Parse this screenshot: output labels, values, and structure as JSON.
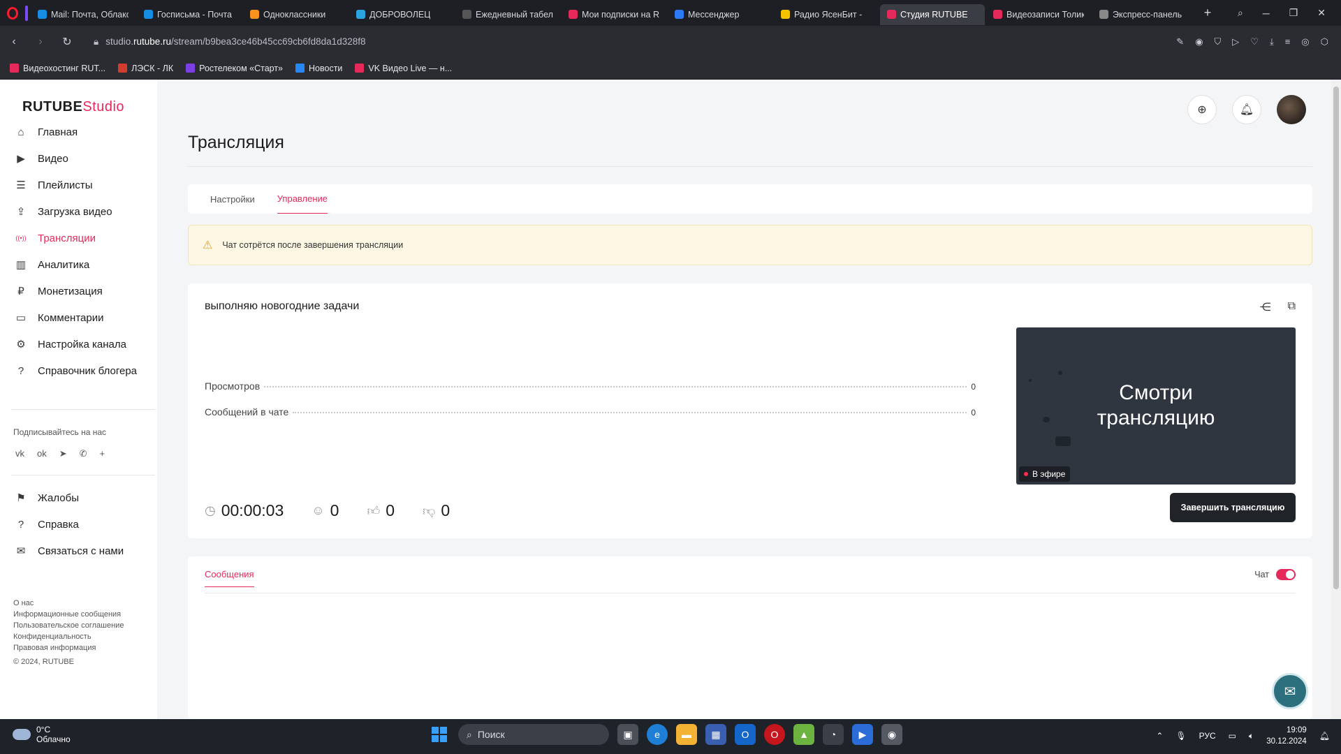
{
  "browser": {
    "tabs": [
      {
        "title": "Mail: Почта, Облако, ",
        "color": "#168de2",
        "active": false
      },
      {
        "title": "Госписьма - Почта M",
        "color": "#168de2",
        "active": false
      },
      {
        "title": "Одноклассники",
        "color": "#f7931e",
        "active": false
      },
      {
        "title": "ДОБРОВОЛЕЦ",
        "color": "#2aa3e0",
        "active": false
      },
      {
        "title": "Ежедневный табель",
        "color": "#555555",
        "active": false
      },
      {
        "title": "Мои подписки на RU",
        "color": "#e6295b",
        "active": false
      },
      {
        "title": "Мессенджер",
        "color": "#2d7bf4",
        "active": false
      },
      {
        "title": "Радио ЯсенБит - ",
        "color": "#f5c400",
        "active": false
      },
      {
        "title": "Студия RUTUBE",
        "color": "#e6295b",
        "active": true
      },
      {
        "title": "Видеозаписи Толика",
        "color": "#e6295b",
        "active": false
      },
      {
        "title": "Экспресс-панель",
        "color": "#888888",
        "active": false
      }
    ],
    "url_prefix": "studio.",
    "url_domain": "rutube.ru",
    "url_path": "/stream/b9bea3ce46b45cc69cb6fd8da1d328f8",
    "bookmarks": [
      {
        "label": "Видеохостинг RUT...",
        "color": "#e6295b"
      },
      {
        "label": "ЛЭСК - ЛК",
        "color": "#d23c2c"
      },
      {
        "label": "Ростелеком «Старт»",
        "color": "#7b3fe4"
      },
      {
        "label": "Новости",
        "color": "#2787f5"
      },
      {
        "label": "VK Видео Live — н...",
        "color": "#e6295b"
      }
    ]
  },
  "app": {
    "logo_main": "RUTUBE",
    "logo_studio": "Studio",
    "nav": [
      {
        "label": "Главная",
        "icon": "home-icon",
        "glyph": "⌂",
        "active": false
      },
      {
        "label": "Видео",
        "icon": "video-icon",
        "glyph": "▶",
        "active": false
      },
      {
        "label": "Плейлисты",
        "icon": "playlist-icon",
        "glyph": "☰",
        "active": false
      },
      {
        "label": "Загрузка видео",
        "icon": "upload-icon",
        "glyph": "⇪",
        "active": false
      },
      {
        "label": "Трансляции",
        "icon": "broadcast-icon",
        "glyph": "((•))",
        "active": true
      },
      {
        "label": "Аналитика",
        "icon": "analytics-icon",
        "glyph": "▥",
        "active": false
      },
      {
        "label": "Монетизация",
        "icon": "ruble-icon",
        "glyph": "₽",
        "active": false
      },
      {
        "label": "Комментарии",
        "icon": "comments-icon",
        "glyph": "▭",
        "active": false
      },
      {
        "label": "Настройка канала",
        "icon": "settings-icon",
        "glyph": "⚙",
        "active": false
      },
      {
        "label": "Справочник блогера",
        "icon": "guide-icon",
        "glyph": "?",
        "active": false
      }
    ],
    "follow_label": "Подписывайтесь на нас",
    "socials": [
      {
        "name": "vk-icon",
        "glyph": "vk"
      },
      {
        "name": "ok-icon",
        "glyph": "ok"
      },
      {
        "name": "telegram-icon",
        "glyph": "➤"
      },
      {
        "name": "viber-icon",
        "glyph": "✆"
      },
      {
        "name": "more-icon",
        "glyph": "+"
      }
    ],
    "nav2": [
      {
        "label": "Жалобы",
        "icon": "flag-icon",
        "glyph": "⚑"
      },
      {
        "label": "Справка",
        "icon": "help-icon",
        "glyph": "?"
      },
      {
        "label": "Связаться с нами",
        "icon": "mail-icon",
        "glyph": "✉"
      }
    ],
    "footer_links": [
      "О нас",
      "Информационные сообщения",
      "Пользовательское соглашение",
      "Конфиденциальность",
      "Правовая информация"
    ],
    "copyright": "© 2024, RUTUBE"
  },
  "main": {
    "page_title": "Трансляция",
    "tabs": [
      {
        "label": "Настройки",
        "active": false
      },
      {
        "label": "Управление",
        "active": true
      }
    ],
    "warning": "Чат сотрётся после завершения трансляции",
    "stream": {
      "title": "выполняю новогодние задачи",
      "stats": [
        {
          "label": "Просмотров",
          "value": "0"
        },
        {
          "label": "Сообщений в чате",
          "value": "0"
        }
      ],
      "preview_text_line1": "Смотри",
      "preview_text_line2": "трансляцию",
      "live_label": "В эфире",
      "duration": "00:00:03",
      "viewers": "0",
      "likes": "0",
      "dislikes": "0",
      "end_button": "Завершить трансляцию"
    },
    "chat": {
      "tab_label": "Сообщения",
      "toggle_label": "Чат",
      "toggle_on": true
    }
  },
  "taskbar": {
    "temperature": "0°C",
    "weather": "Облачно",
    "search_placeholder": "Поиск",
    "language": "РУС",
    "time": "19:09",
    "date": "30.12.2024"
  },
  "colors": {
    "accent": "#e6295b",
    "warning_bg": "#fdf7e3",
    "dark_button": "#202328"
  }
}
